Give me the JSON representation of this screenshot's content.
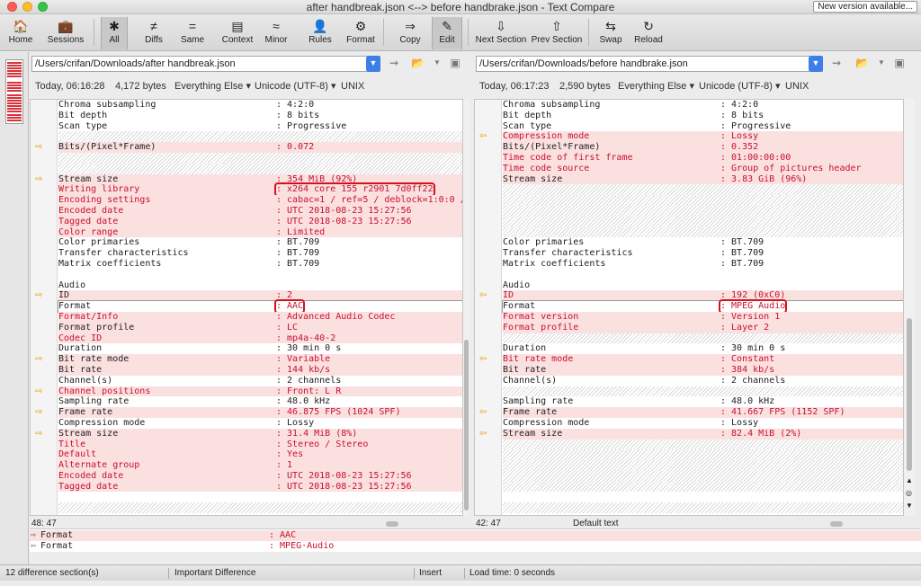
{
  "window": {
    "title": "after handbreak.json <--> before handbrake.json - Text Compare",
    "new_version": "New version available..."
  },
  "toolbar": [
    {
      "label": "Home",
      "icon": "🏠"
    },
    {
      "label": "Sessions",
      "icon": "💼"
    },
    {
      "label": "All",
      "icon": "✱"
    },
    {
      "label": "Diffs",
      "icon": "≠"
    },
    {
      "label": "Same",
      "icon": "="
    },
    {
      "label": "Context",
      "icon": "▤"
    },
    {
      "label": "Minor",
      "icon": "≈"
    },
    {
      "label": "Rules",
      "icon": "👤"
    },
    {
      "label": "Format",
      "icon": "⚙"
    },
    {
      "label": "Copy",
      "icon": "⇒"
    },
    {
      "label": "Edit",
      "icon": "✎"
    },
    {
      "label": "Next Section",
      "icon": "⇩"
    },
    {
      "label": "Prev Section",
      "icon": "⇧"
    },
    {
      "label": "Swap",
      "icon": "⇆"
    },
    {
      "label": "Reload",
      "icon": "↻"
    }
  ],
  "left": {
    "path": "/Users/crifan/Downloads/after handbreak.json",
    "timestamp": "Today, 06:16:28",
    "size": "4,172 bytes",
    "filter": "Everything Else ▾",
    "encoding": "Unicode (UTF-8) ▾",
    "eol": "UNIX",
    "cursor": "48: 47",
    "lines": [
      {
        "k": "Chroma subsampling",
        "v": ": 4:2:0",
        "t": "n"
      },
      {
        "k": "Bit depth",
        "v": ": 8 bits",
        "t": "n"
      },
      {
        "k": "Scan type",
        "v": ": Progressive",
        "t": "n"
      },
      {
        "k": "",
        "v": "",
        "t": "b"
      },
      {
        "k": "Bits/(Pixel*Frame)",
        "v": ": 0.072",
        "t": "d"
      },
      {
        "k": "",
        "v": "",
        "t": "b"
      },
      {
        "k": "",
        "v": "",
        "t": "b"
      },
      {
        "k": "Stream size",
        "v": ": 354 MiB (92%)",
        "t": "d"
      },
      {
        "k": "Writing library",
        "v": ": x264 core 155 r2901 7d0ff22",
        "t": "dr"
      },
      {
        "k": "Encoding settings",
        "v": ": cabac=1 / ref=5 / deblock=1:0:0 /",
        "t": "dr"
      },
      {
        "k": "Encoded date",
        "v": ": UTC 2018-08-23 15:27:56",
        "t": "dr"
      },
      {
        "k": "Tagged date",
        "v": ": UTC 2018-08-23 15:27:56",
        "t": "dr"
      },
      {
        "k": "Color range",
        "v": ": Limited",
        "t": "dr"
      },
      {
        "k": "Color primaries",
        "v": ": BT.709",
        "t": "n"
      },
      {
        "k": "Transfer characteristics",
        "v": ": BT.709",
        "t": "n"
      },
      {
        "k": "Matrix coefficients",
        "v": ": BT.709",
        "t": "n"
      },
      {
        "k": "",
        "v": "",
        "t": "n"
      },
      {
        "k": "Audio",
        "v": "",
        "t": "n"
      },
      {
        "k": "ID",
        "v": ": 2",
        "t": "d"
      },
      {
        "k": "Format",
        "v": ": AAC",
        "t": "f"
      },
      {
        "k": "Format/Info",
        "v": ": Advanced Audio Codec",
        "t": "dr"
      },
      {
        "k": "Format profile",
        "v": ": LC",
        "t": "d"
      },
      {
        "k": "Codec ID",
        "v": ": mp4a-40-2",
        "t": "dr"
      },
      {
        "k": "Duration",
        "v": ": 30 min 0 s",
        "t": "n"
      },
      {
        "k": "Bit rate mode",
        "v": ": Variable",
        "t": "d"
      },
      {
        "k": "Bit rate",
        "v": ": 144 kb/s",
        "t": "d"
      },
      {
        "k": "Channel(s)",
        "v": ": 2 channels",
        "t": "n"
      },
      {
        "k": "Channel positions",
        "v": ": Front: L R",
        "t": "dr"
      },
      {
        "k": "Sampling rate",
        "v": ": 48.0 kHz",
        "t": "n"
      },
      {
        "k": "Frame rate",
        "v": ": 46.875 FPS (1024 SPF)",
        "t": "d"
      },
      {
        "k": "Compression mode",
        "v": ": Lossy",
        "t": "n"
      },
      {
        "k": "Stream size",
        "v": ": 31.4 MiB (8%)",
        "t": "d"
      },
      {
        "k": "Title",
        "v": ": Stereo / Stereo",
        "t": "dr"
      },
      {
        "k": "Default",
        "v": ": Yes",
        "t": "dr"
      },
      {
        "k": "Alternate group",
        "v": ": 1",
        "t": "dr"
      },
      {
        "k": "Encoded date",
        "v": ": UTC 2018-08-23 15:27:56",
        "t": "dr"
      },
      {
        "k": "Tagged date",
        "v": ": UTC 2018-08-23 15:27:56",
        "t": "dr"
      },
      {
        "k": "",
        "v": "",
        "t": "n"
      },
      {
        "k": "",
        "v": "",
        "t": "b"
      }
    ]
  },
  "right": {
    "path": "/Users/crifan/Downloads/before handbrake.json",
    "timestamp": "Today, 06:17:23",
    "size": "2,590 bytes",
    "filter": "Everything Else ▾",
    "encoding": "Unicode (UTF-8) ▾",
    "eol": "UNIX",
    "cursor": "42: 47",
    "cursor_label": "Default text",
    "lines": [
      {
        "k": "Chroma subsampling",
        "v": ": 4:2:0",
        "t": "n"
      },
      {
        "k": "Bit depth",
        "v": ": 8 bits",
        "t": "n"
      },
      {
        "k": "Scan type",
        "v": ": Progressive",
        "t": "n"
      },
      {
        "k": "Compression mode",
        "v": ": Lossy",
        "t": "dr"
      },
      {
        "k": "Bits/(Pixel*Frame)",
        "v": ": 0.352",
        "t": "d"
      },
      {
        "k": "Time code of first frame",
        "v": ": 01:00:00:00",
        "t": "dr"
      },
      {
        "k": "Time code source",
        "v": ": Group of pictures header",
        "t": "dr"
      },
      {
        "k": "Stream size",
        "v": ": 3.83 GiB (96%)",
        "t": "d"
      },
      {
        "k": "",
        "v": "",
        "t": "b"
      },
      {
        "k": "",
        "v": "",
        "t": "b"
      },
      {
        "k": "",
        "v": "",
        "t": "b"
      },
      {
        "k": "",
        "v": "",
        "t": "b"
      },
      {
        "k": "",
        "v": "",
        "t": "b"
      },
      {
        "k": "Color primaries",
        "v": ": BT.709",
        "t": "n"
      },
      {
        "k": "Transfer characteristics",
        "v": ": BT.709",
        "t": "n"
      },
      {
        "k": "Matrix coefficients",
        "v": ": BT.709",
        "t": "n"
      },
      {
        "k": "",
        "v": "",
        "t": "n"
      },
      {
        "k": "Audio",
        "v": "",
        "t": "n"
      },
      {
        "k": "ID",
        "v": ": 192 (0xC0)",
        "t": "dr"
      },
      {
        "k": "Format",
        "v": ": MPEG Audio",
        "t": "f"
      },
      {
        "k": "Format version",
        "v": ": Version 1",
        "t": "dr"
      },
      {
        "k": "Format profile",
        "v": ": Layer 2",
        "t": "dr"
      },
      {
        "k": "",
        "v": "",
        "t": "b"
      },
      {
        "k": "Duration",
        "v": ": 30 min 0 s",
        "t": "n"
      },
      {
        "k": "Bit rate mode",
        "v": ": Constant",
        "t": "dr"
      },
      {
        "k": "Bit rate",
        "v": ": 384 kb/s",
        "t": "d"
      },
      {
        "k": "Channel(s)",
        "v": ": 2 channels",
        "t": "n"
      },
      {
        "k": "",
        "v": "",
        "t": "b"
      },
      {
        "k": "Sampling rate",
        "v": ": 48.0 kHz",
        "t": "n"
      },
      {
        "k": "Frame rate",
        "v": ": 41.667 FPS (1152 SPF)",
        "t": "d"
      },
      {
        "k": "Compression mode",
        "v": ": Lossy",
        "t": "n"
      },
      {
        "k": "Stream size",
        "v": ": 82.4 MiB (2%)",
        "t": "d"
      },
      {
        "k": "",
        "v": "",
        "t": "b"
      },
      {
        "k": "",
        "v": "",
        "t": "b"
      },
      {
        "k": "",
        "v": "",
        "t": "b"
      },
      {
        "k": "",
        "v": "",
        "t": "b"
      },
      {
        "k": "",
        "v": "",
        "t": "b"
      },
      {
        "k": "",
        "v": "",
        "t": "n"
      },
      {
        "k": "",
        "v": "",
        "t": "b"
      }
    ]
  },
  "compare": {
    "left_key": "Format",
    "left_val": ": AAC",
    "right_key": "Format",
    "right_val": ": MPEG·Audio"
  },
  "status": {
    "sections": "12 difference section(s)",
    "importance": "Important Difference",
    "mode": "Insert",
    "load": "Load time: 0 seconds"
  }
}
